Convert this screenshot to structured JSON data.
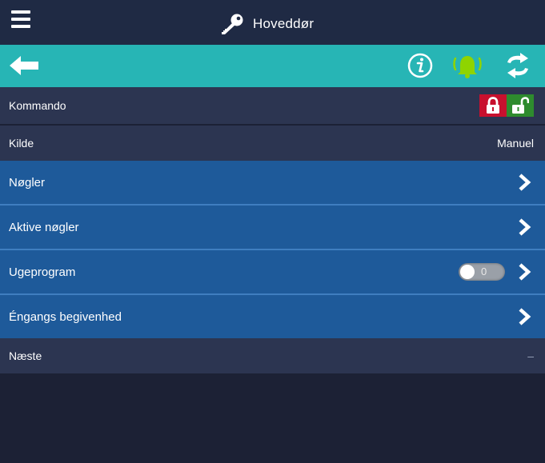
{
  "header": {
    "title": "Hoveddør",
    "menu_icon": "hamburger-menu-icon",
    "title_icon": "key-icon"
  },
  "actionbar": {
    "back_icon": "arrow-left-icon",
    "info_icon": "info-icon",
    "bell_icon": "alarm-bell-icon",
    "refresh_icon": "refresh-icon",
    "bell_color": "#8fd400"
  },
  "rows": {
    "kommando": {
      "label": "Kommando",
      "lock_icon": "lock-closed-icon",
      "unlock_icon": "lock-open-icon"
    },
    "kilde": {
      "label": "Kilde",
      "value": "Manuel"
    },
    "nogler": {
      "label": "Nøgler"
    },
    "aktive_nogler": {
      "label": "Aktive nøgler"
    },
    "ugeprogram": {
      "label": "Ugeprogram",
      "toggle_value": "0",
      "toggle_on": false
    },
    "engangs": {
      "label": "Éngangs begivenhed"
    },
    "naeste": {
      "label": "Næste",
      "value": "–"
    }
  },
  "colors": {
    "topbar": "#1f2a44",
    "actionbar": "#27b5b5",
    "row_gray": "#2c3551",
    "row_blue": "#1e5a9a",
    "lock_red": "#c8102e",
    "lock_green": "#2e8b2e",
    "background": "#1c2135"
  }
}
